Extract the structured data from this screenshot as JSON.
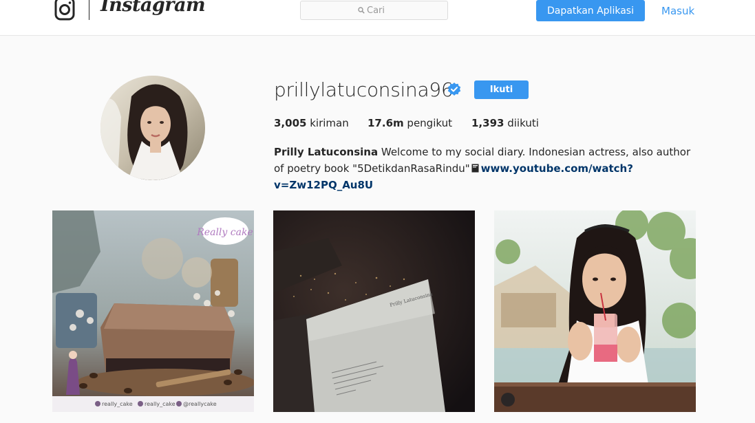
{
  "header": {
    "brand": "Instagram",
    "search_placeholder": "Cari",
    "get_app_label": "Dapatkan Aplikasi",
    "login_label": "Masuk"
  },
  "profile": {
    "username": "prillylatuconsina96",
    "follow_label": "Ikuti",
    "stats": {
      "posts_count": "3,005",
      "posts_label": "kiriman",
      "followers_count": "17.6m",
      "followers_label": "pengikut",
      "following_count": "1,393",
      "following_label": "diikuti"
    },
    "bio": {
      "full_name": "Prilly Latuconsina",
      "text": "Welcome to my social diary. Indonesian actress, also author of poetry book \"5DetikdanRasaRindu\"",
      "link": "www.youtube.com/watch?v=Zw12PQ_Au8U"
    }
  },
  "posts": [
    {
      "subject": "chocolate cake with coffee beans",
      "watermark": "Really cake",
      "handles": [
        "really_cake",
        "really_cake",
        "@reallycake"
      ]
    },
    {
      "subject": "open book at night over city lights",
      "book_header": "Prilly Latuconsina"
    },
    {
      "subject": "woman sipping red drink"
    }
  ],
  "colors": {
    "accent": "#3897f0",
    "link": "#003569",
    "background": "#fafafa",
    "verified": "#3897f0"
  }
}
